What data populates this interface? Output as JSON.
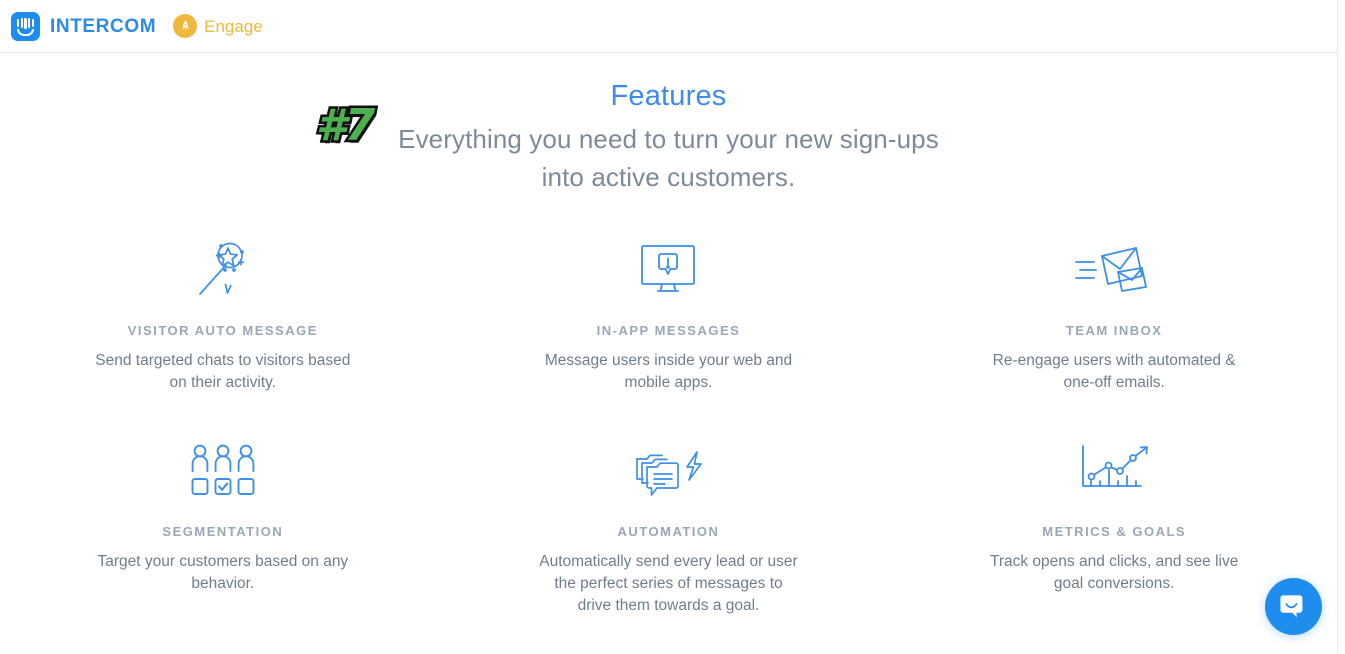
{
  "header": {
    "logo_icon": "intercom-logo-icon",
    "brand_name": "INTERCOM",
    "product_icon": "rocket-icon",
    "product_label": "Engage"
  },
  "sticker": {
    "label": "#7",
    "color": "#4caf50",
    "outline_color": "#111111"
  },
  "hero": {
    "title": "Features",
    "title_color": "#3d8bef",
    "subtitle_line1": "Everything you need to turn your new sign-ups",
    "subtitle_line2": "into active customers.",
    "subtitle_color": "#7d8b99"
  },
  "features": [
    {
      "icon": "magic-wand-speech-bubble-icon",
      "title": "VISITOR AUTO MESSAGE",
      "desc_line1": "Send targeted chats to visitors based",
      "desc_line2": "on their activity.",
      "desc_line3": ""
    },
    {
      "icon": "desktop-monitor-alert-icon",
      "title": "IN-APP MESSAGES",
      "desc_line1": "Message users inside your web and",
      "desc_line2": "mobile apps.",
      "desc_line3": ""
    },
    {
      "icon": "flying-envelopes-icon",
      "title": "TEAM INBOX",
      "desc_line1": "Re-engage users with automated &",
      "desc_line2": "one-off emails.",
      "desc_line3": ""
    },
    {
      "icon": "people-checkboxes-icon",
      "title": "SEGMENTATION",
      "desc_line1": "Target your customers based on any",
      "desc_line2": "behavior.",
      "desc_line3": ""
    },
    {
      "icon": "stacked-messages-lightning-icon",
      "title": "AUTOMATION",
      "desc_line1": "Automatically send every lead or user",
      "desc_line2": "the perfect series of messages to",
      "desc_line3": "drive them towards a goal."
    },
    {
      "icon": "line-chart-arrow-icon",
      "title": "METRICS & GOALS",
      "desc_line1": "Track opens and clicks, and see live",
      "desc_line2": "goal conversions.",
      "desc_line3": ""
    }
  ],
  "messenger": {
    "icon": "intercom-messenger-icon",
    "color": "#1f8ded"
  },
  "theme": {
    "accent_blue": "#1f8ded",
    "icon_blue": "#3d8fe8",
    "gold": "#edb83c",
    "text_gray": "#6f7e8d",
    "title_gray": "#9aa7b5",
    "background": "#ffffff"
  }
}
